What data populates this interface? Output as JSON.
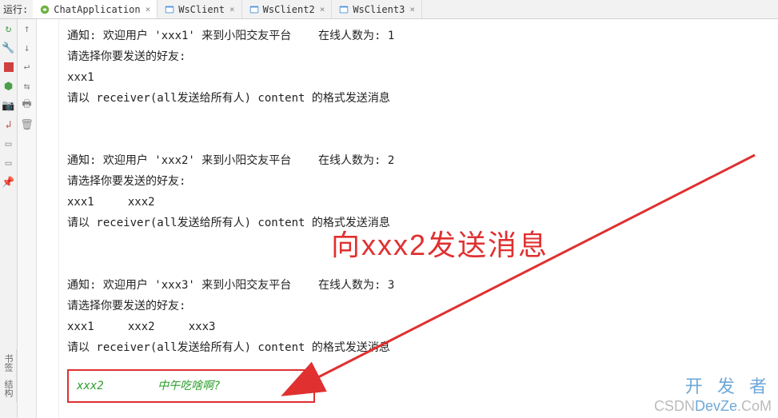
{
  "topBar": {
    "runLabel": "运行:",
    "tabs": [
      {
        "label": "ChatApplication",
        "active": true
      },
      {
        "label": "WsClient",
        "active": false
      },
      {
        "label": "WsClient2",
        "active": false
      },
      {
        "label": "WsClient3",
        "active": false
      }
    ],
    "closeGlyph": "×"
  },
  "console": {
    "block1": {
      "line1": "通知: 欢迎用户 'xxx1' 来到小阳交友平台    在线人数为: 1",
      "line2": "请选择你要发送的好友:",
      "line3": "xxx1",
      "line4": "请以 receiver(all发送给所有人) content 的格式发送消息"
    },
    "block2": {
      "line1": "通知: 欢迎用户 'xxx2' 来到小阳交友平台    在线人数为: 2",
      "line2": "请选择你要发送的好友:",
      "line3": "xxx1     xxx2",
      "line4": "请以 receiver(all发送给所有人) content 的格式发送消息"
    },
    "block3": {
      "line1": "通知: 欢迎用户 'xxx3' 来到小阳交友平台    在线人数为: 3",
      "line2": "请选择你要发送的好友:",
      "line3": "xxx1     xxx2     xxx3",
      "line4": "请以 receiver(all发送给所有人) content 的格式发送消息"
    },
    "input": {
      "receiver": "xxx2",
      "content": "中午吃啥啊?"
    }
  },
  "annotation": {
    "text": "向xxx2发送消息"
  },
  "sideTabs": {
    "tab1": "书签",
    "tab2": "结构"
  },
  "watermark": {
    "line1": "开 发 者",
    "line2_gray": "CSDN",
    "line2_blue": "DevZe",
    "line2_gray2": "CoM"
  },
  "icons": {
    "rerun": "rerun-icon",
    "wrench": "wrench-icon",
    "stop": "stop-icon",
    "bug": "bug-icon",
    "camera": "camera-icon",
    "exit": "exit-icon",
    "collapse": "collapse-icon",
    "pin": "pin-icon",
    "down": "down-arrow-icon",
    "up": "up-arrow-icon",
    "wrap": "wrap-icon",
    "print": "print-icon",
    "trash": "trash-icon"
  }
}
